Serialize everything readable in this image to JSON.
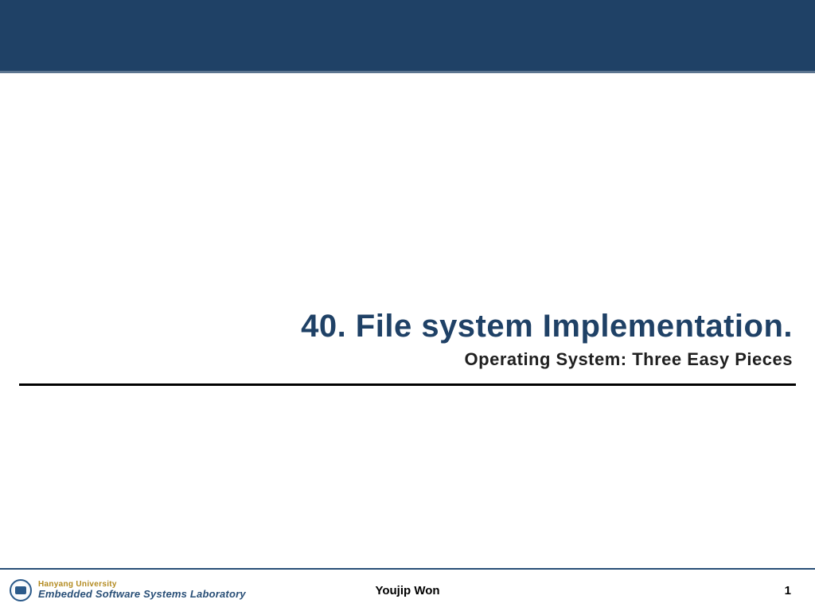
{
  "title": "40. File system Implementation.",
  "subtitle": "Operating System: Three Easy Pieces",
  "footer": {
    "university": "Hanyang University",
    "lab": "Embedded Software Systems Laboratory",
    "author": "Youjip Won",
    "page": "1"
  }
}
